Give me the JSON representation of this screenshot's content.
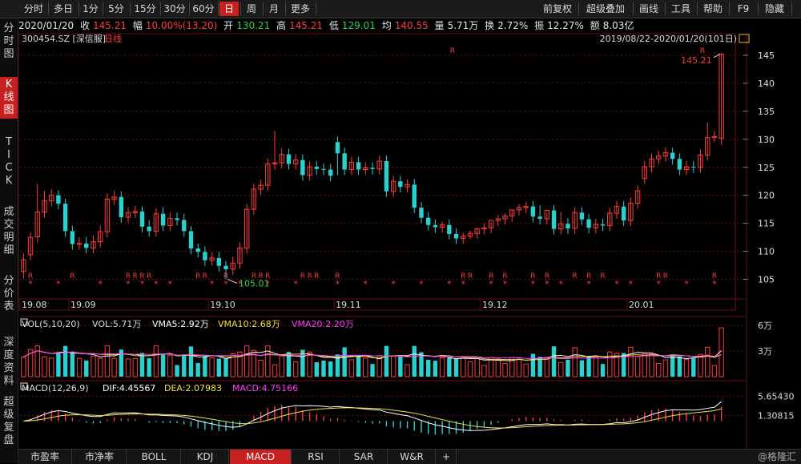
{
  "toolbar": {
    "tabs": [
      "分时",
      "多日",
      "1分",
      "5分",
      "15分",
      "30分",
      "60分",
      "日",
      "周",
      "月",
      "更多"
    ],
    "active_tab": "日",
    "right": [
      "前复权",
      "超级叠加",
      "画线",
      "工具",
      "帮助",
      "F9",
      "隐藏"
    ]
  },
  "sidebar": [
    {
      "label": "分时图",
      "active": false
    },
    {
      "label": "K线图",
      "active": true
    },
    {
      "label": "TICK",
      "active": false
    },
    {
      "label": "成交明细",
      "active": false
    },
    {
      "label": "分价表",
      "active": false
    },
    {
      "label": "深度资料",
      "active": false
    },
    {
      "label": "超级复盘",
      "active": false
    }
  ],
  "quote": {
    "date": "2020/01/20",
    "close_label": "收",
    "close": "145.21",
    "change_label": "幅",
    "change": "10.00%(13.20)",
    "open_label": "开",
    "open": "130.21",
    "high_label": "高",
    "high": "145.21",
    "low_label": "低",
    "low": "129.01",
    "avg_label": "均",
    "avg": "140.55",
    "volume_label": "量",
    "volume": "5.71万",
    "turnover_label": "换",
    "turnover": "2.72%",
    "amplitude_label": "振",
    "amplitude": "12.27%",
    "amount_label": "额",
    "amount": "8.03亿"
  },
  "main_chart": {
    "stock": "300454.SZ [深信服]",
    "period": "日线",
    "range": "2019/08/22-2020/01/20(101日)",
    "max_label": "145.21",
    "min_label": "105.01",
    "y_ticks": [
      145,
      140,
      135,
      130,
      125,
      120,
      115,
      110,
      105
    ],
    "ylim": [
      101.5,
      147.0
    ],
    "x_labels": [
      {
        "text": "19.08",
        "i": 0
      },
      {
        "text": "19.09",
        "i": 7
      },
      {
        "text": "19.10",
        "i": 27
      },
      {
        "text": "19.11",
        "i": 45
      },
      {
        "text": "19.12",
        "i": 66
      },
      {
        "text": "20.01",
        "i": 87
      }
    ]
  },
  "markers_R": [
    1,
    7,
    15,
    16,
    17,
    18,
    25,
    26,
    29,
    33,
    34,
    35,
    40,
    41,
    42,
    45,
    63,
    64,
    67,
    69,
    73,
    75,
    79,
    81,
    83,
    91,
    92,
    99
  ],
  "markers_star": [
    1,
    5,
    11,
    15,
    17,
    19,
    21,
    27,
    29,
    31,
    35,
    39,
    45,
    49,
    53,
    57,
    61,
    63,
    67,
    69,
    73,
    75,
    77,
    81,
    85,
    87,
    91,
    95,
    99
  ],
  "chart_data": {
    "type": "candlestick",
    "count": 101,
    "close": [
      108.5,
      112.5,
      117,
      119,
      120,
      118.5,
      113.6,
      111.3,
      111.4,
      110.6,
      111.7,
      113.5,
      119.3,
      119.7,
      116.1,
      116.9,
      117.1,
      114.4,
      113.6,
      116.7,
      114.6,
      115.9,
      115.6,
      113.6,
      110.5,
      109.9,
      108.4,
      108.8,
      107.4,
      106.8,
      107.9,
      110.6,
      117.5,
      121.1,
      121.8,
      125.6,
      125.8,
      127.3,
      125.6,
      126.3,
      123.6,
      125.1,
      124.7,
      124.6,
      123.5,
      127.5,
      124.6,
      125.9,
      124.6,
      124.9,
      124.7,
      126.1,
      120.7,
      122.5,
      121.5,
      121.9,
      117.8,
      116.0,
      114.7,
      114.3,
      114.7,
      113.1,
      112.3,
      112.7,
      113.2,
      114.0,
      114.2,
      115.5,
      115.8,
      116.3,
      117.4,
      117.8,
      118.0,
      116.2,
      115.8,
      117.3,
      114.0,
      114.9,
      114.1,
      116.9,
      115.7,
      114.2,
      114.8,
      114.6,
      116.8,
      118.0,
      115.5,
      118.6,
      120.8,
      125.1,
      126.5,
      127.0,
      127.6,
      126.5,
      124.6,
      125.1,
      125.0,
      127.2,
      130.3,
      130.5,
      145.21
    ],
    "open": [
      106.4,
      109.4,
      112.6,
      117.0,
      119.0,
      120.0,
      118.5,
      113.6,
      111.3,
      111.4,
      110.6,
      111.7,
      113.5,
      119.3,
      119.7,
      116.1,
      116.9,
      117.1,
      114.4,
      113.6,
      116.7,
      114.6,
      115.9,
      115.6,
      113.6,
      110.5,
      109.9,
      108.4,
      108.8,
      107.4,
      106.8,
      107.9,
      110.6,
      117.5,
      121.1,
      121.8,
      125.6,
      125.8,
      127.3,
      125.6,
      126.3,
      123.6,
      125.1,
      124.7,
      124.6,
      129.5,
      127.5,
      124.6,
      125.9,
      124.6,
      124.9,
      124.7,
      126.1,
      120.7,
      122.5,
      121.5,
      121.9,
      117.8,
      116.0,
      114.7,
      114.3,
      114.7,
      113.1,
      112.3,
      112.7,
      113.2,
      114.0,
      114.2,
      115.5,
      115.8,
      116.3,
      117.4,
      117.8,
      118.0,
      116.2,
      115.8,
      117.3,
      114.0,
      114.9,
      114.1,
      116.9,
      115.7,
      114.2,
      114.8,
      114.6,
      116.8,
      118.0,
      115.5,
      118.6,
      123.0,
      125.1,
      126.5,
      127.0,
      127.6,
      126.5,
      124.6,
      125.1,
      125.0,
      127.2,
      130.3,
      130.21
    ],
    "high": [
      109.6,
      113.4,
      122.0,
      120.8,
      121.1,
      120.9,
      119.4,
      114.6,
      112.5,
      112.6,
      112.8,
      114.6,
      120.3,
      120.8,
      120.7,
      117.9,
      118.1,
      118.0,
      115.6,
      117.7,
      117.9,
      116.9,
      116.9,
      116.7,
      114.5,
      111.4,
      110.9,
      109.8,
      109.9,
      108.3,
      109.0,
      111.6,
      118.5,
      122.1,
      122.8,
      126.6,
      131.5,
      128.4,
      128.3,
      127.4,
      127.3,
      126.1,
      126.1,
      125.7,
      125.6,
      130.5,
      128.5,
      126.9,
      126.9,
      125.9,
      125.9,
      127.1,
      127.1,
      123.5,
      123.5,
      122.9,
      122.9,
      118.8,
      117.0,
      115.7,
      115.3,
      115.7,
      114.1,
      113.3,
      113.7,
      114.2,
      115.0,
      115.2,
      116.5,
      116.8,
      117.3,
      118.4,
      118.8,
      119.0,
      118.2,
      116.8,
      118.3,
      117.0,
      115.9,
      117.9,
      117.9,
      116.7,
      115.8,
      115.8,
      117.8,
      119.0,
      119.0,
      119.6,
      121.8,
      126.1,
      127.5,
      128.0,
      128.6,
      128.5,
      127.5,
      126.1,
      126.1,
      128.2,
      133.0,
      131.5,
      145.21
    ],
    "low": [
      105.1,
      108.4,
      111.6,
      116.0,
      118.0,
      117.5,
      112.6,
      110.3,
      110.3,
      109.6,
      109.6,
      110.7,
      112.5,
      118.3,
      115.1,
      115.1,
      115.9,
      113.4,
      112.6,
      112.6,
      113.6,
      113.6,
      114.6,
      112.6,
      109.5,
      108.9,
      107.4,
      107.4,
      106.4,
      105.01,
      105.8,
      106.9,
      109.6,
      116.5,
      120.1,
      120.8,
      124.6,
      124.8,
      124.6,
      124.6,
      122.6,
      122.6,
      123.7,
      123.6,
      122.5,
      123.6,
      123.6,
      123.6,
      123.6,
      123.6,
      123.7,
      123.7,
      119.7,
      119.7,
      120.5,
      120.5,
      116.8,
      115.0,
      113.7,
      113.3,
      113.3,
      112.1,
      111.3,
      111.3,
      112.2,
      112.2,
      113.0,
      113.2,
      114.5,
      114.8,
      115.3,
      116.4,
      116.8,
      115.2,
      114.8,
      114.8,
      113.0,
      113.0,
      113.1,
      113.1,
      114.7,
      113.2,
      113.2,
      113.6,
      113.6,
      115.8,
      114.5,
      114.5,
      117.6,
      122.0,
      124.1,
      125.5,
      126.0,
      125.5,
      123.6,
      123.6,
      124.0,
      124.0,
      126.2,
      129.5,
      129.01
    ]
  },
  "volume_panel": {
    "indicator": "VOL(5,10,20)",
    "vol_label": "VOL:5.71万",
    "vma5": "VMA5:2.92万",
    "vma10": "VMA10:2.68万",
    "vma20": "VMA20:2.20万",
    "y_ticks": [
      "6万",
      "3万"
    ]
  },
  "macd_panel": {
    "indicator": "MACD(12,26,9)",
    "dif": "DIF:4.45567",
    "dea": "DEA:2.07983",
    "macd": "MACD:4.75166",
    "y_ticks": [
      "5.65430",
      "1.30815"
    ]
  },
  "bottom_tabs": [
    "市盈率",
    "市净率",
    "BOLL",
    "KDJ",
    "MACD",
    "RSI",
    "SAR",
    "W&R",
    "+"
  ],
  "active_bottom_tab": "MACD",
  "watermark": "@格隆汇",
  "colors": {
    "up": "#ff3b3b",
    "down": "#29d1d1",
    "grid": "#6b1010",
    "bg": "#000000"
  }
}
